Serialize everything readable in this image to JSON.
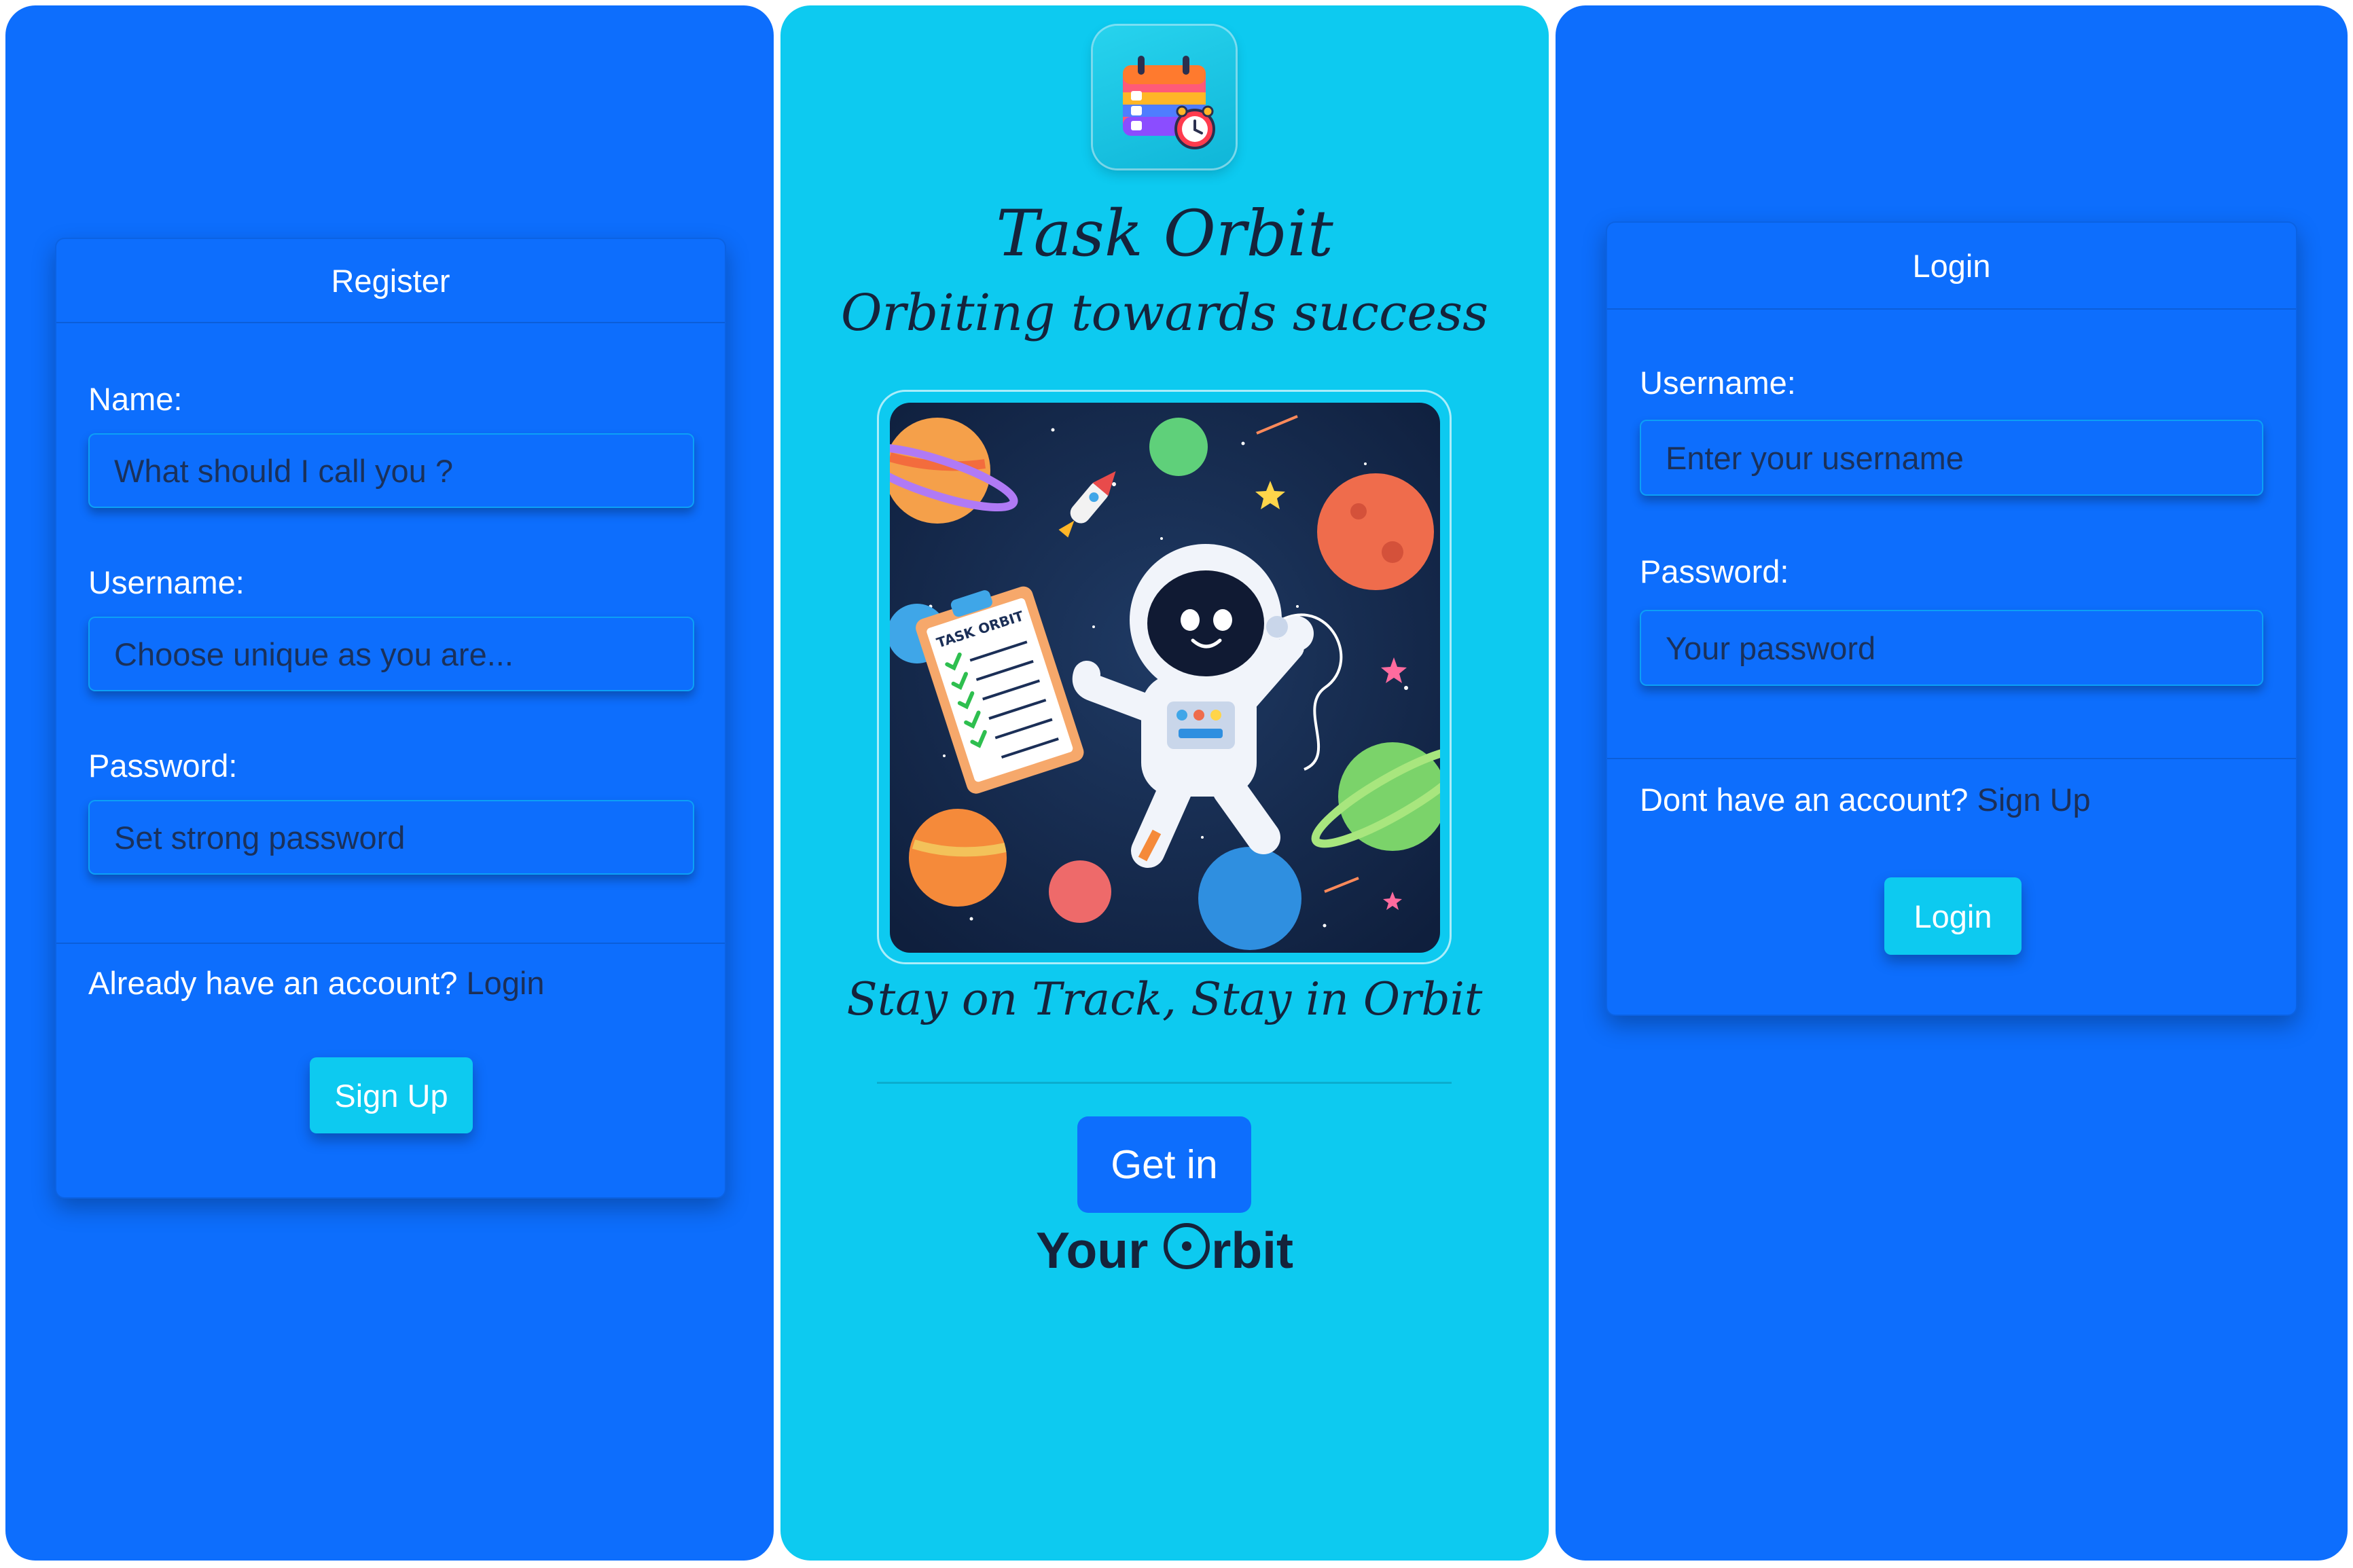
{
  "register": {
    "title": "Register",
    "name_label": "Name:",
    "name_placeholder": "What should I call you ?",
    "username_label": "Username:",
    "username_placeholder": "Choose unique as you are...",
    "password_label": "Password:",
    "password_placeholder": "Set strong password",
    "footer_text": "Already have an account?",
    "footer_link": "Login",
    "submit_label": "Sign Up"
  },
  "landing": {
    "app_name": "Task Orbit",
    "tagline": "Orbiting towards success",
    "clipboard_text": "TASK ORBIT",
    "slogan": "Stay on Track, Stay in Orbit",
    "cta_label": "Get in",
    "cta_subtitle_before": "Your",
    "cta_subtitle_after": "rbit"
  },
  "login": {
    "title": "Login",
    "username_label": "Username:",
    "username_placeholder": "Enter your username",
    "password_label": "Password:",
    "password_placeholder": "Your password",
    "footer_text": "Dont have an account?",
    "footer_link": "Sign Up",
    "submit_label": "Login"
  },
  "colors": {
    "primary": "#0d6efd",
    "info": "#0dcaf0",
    "dark_text": "#15233b"
  }
}
